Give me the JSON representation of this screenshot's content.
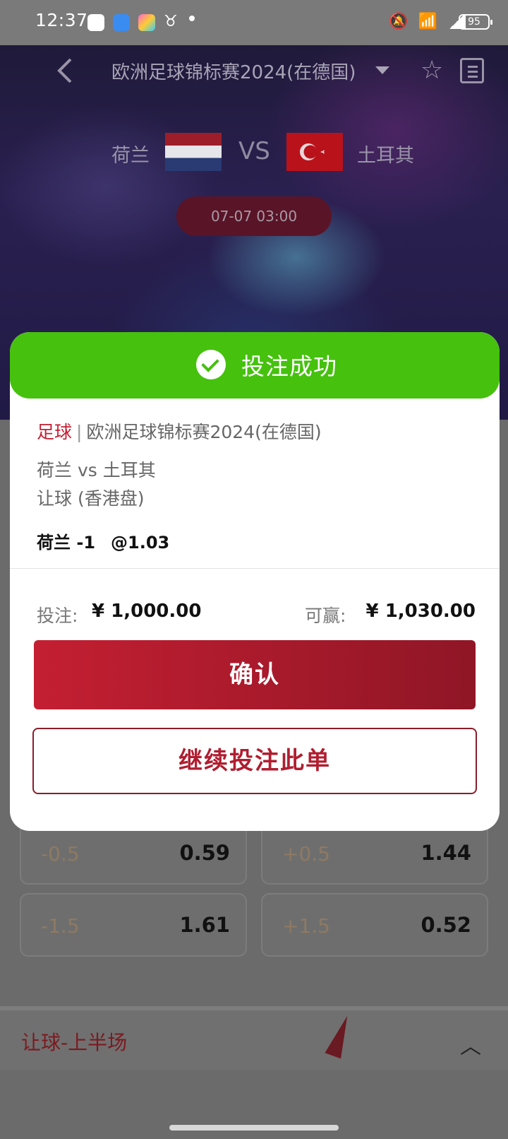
{
  "status_bar": {
    "time": "12:37",
    "battery": "95"
  },
  "header": {
    "title": "欧洲足球锦标赛2024(在德国)",
    "home_team": "荷兰",
    "vs": "VS",
    "away_team": "土耳其",
    "kickoff": "07-07 03:00"
  },
  "odds_rows": [
    {
      "left_hcap": "-0.5",
      "left_odds": "0.59",
      "right_hcap": "+0.5",
      "right_odds": "1.44"
    },
    {
      "left_hcap": "-1.5",
      "left_odds": "1.61",
      "right_hcap": "+1.5",
      "right_odds": "0.52"
    }
  ],
  "section": {
    "title": "让球-上半场"
  },
  "modal": {
    "header": "投注成功",
    "sport": "足球",
    "separator": "|",
    "league": "欧洲足球锦标赛2024(在德国)",
    "match": "荷兰 vs 土耳其",
    "market": "让球 (香港盘)",
    "pick": "荷兰 -1",
    "pick_odds": "@1.03",
    "stake_label": "投注:",
    "stake": "¥ 1,000.00",
    "win_label": "可赢:",
    "win": "¥ 1,030.00",
    "confirm_label": "确认",
    "continue_label": "继续投注此单"
  }
}
